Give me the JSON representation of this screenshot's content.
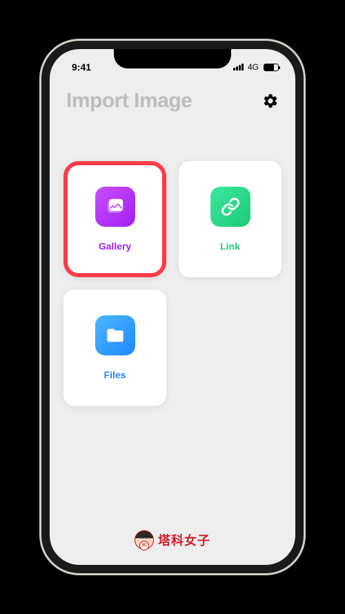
{
  "status": {
    "time": "9:41",
    "network": "4G"
  },
  "header": {
    "title": "Import Image"
  },
  "cards": {
    "gallery": {
      "label": "Gallery",
      "highlighted": true
    },
    "link": {
      "label": "Link"
    },
    "files": {
      "label": "Files"
    }
  },
  "footer": {
    "logo_text": "塔科女子"
  }
}
